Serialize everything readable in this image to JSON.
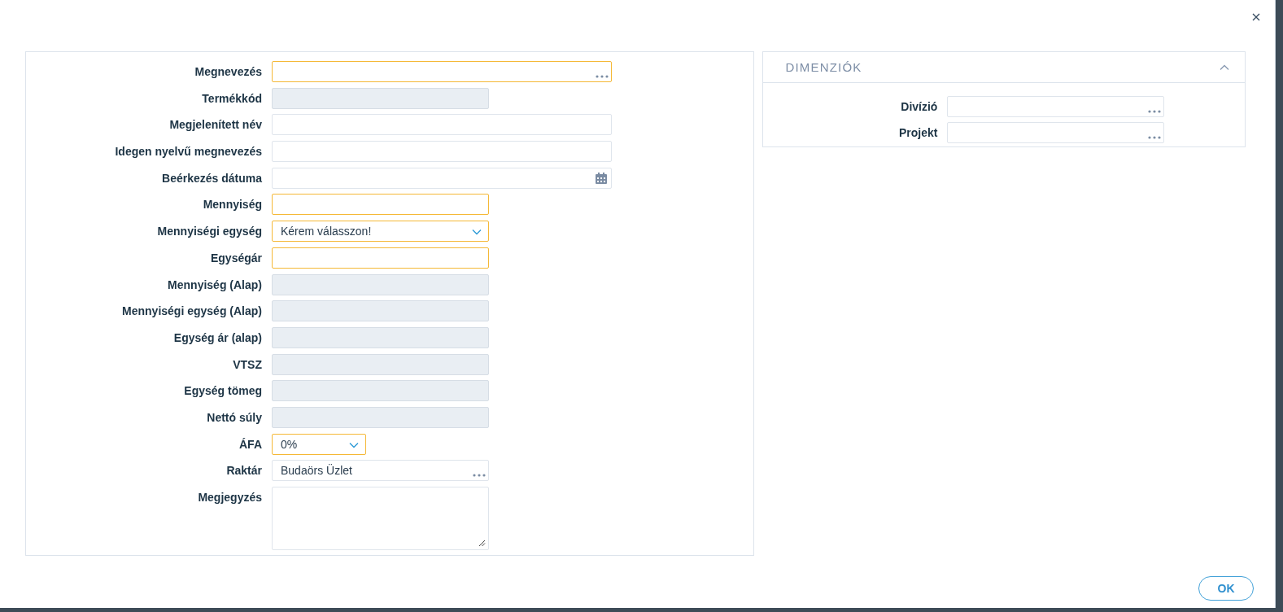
{
  "form": {
    "fields": [
      {
        "label": "Megnevezés",
        "kind": "lookup",
        "required": true
      },
      {
        "label": "Termékkód",
        "kind": "readonly"
      },
      {
        "label": "Megjelenített név",
        "kind": "text",
        "required": false
      },
      {
        "label": "Idegen nyelvű megnevezés",
        "kind": "text",
        "required": false
      },
      {
        "label": "Beérkezés dátuma",
        "kind": "date",
        "required": false
      },
      {
        "label": "Mennyiség",
        "kind": "text",
        "required": true
      },
      {
        "label": "Mennyiségi egység",
        "kind": "select",
        "required": true,
        "value": "Kérem válasszon!"
      },
      {
        "label": "Egységár",
        "kind": "text",
        "required": true
      },
      {
        "label": "Mennyiség (Alap)",
        "kind": "readonly"
      },
      {
        "label": "Mennyiségi egység (Alap)",
        "kind": "readonly"
      },
      {
        "label": "Egység ár (alap)",
        "kind": "readonly"
      },
      {
        "label": "VTSZ",
        "kind": "readonly"
      },
      {
        "label": "Egység tömeg",
        "kind": "readonly"
      },
      {
        "label": "Nettó súly",
        "kind": "readonly"
      },
      {
        "label": "ÁFA",
        "kind": "select",
        "required": true,
        "value": "0%"
      },
      {
        "label": "Raktár",
        "kind": "lookup",
        "required": false,
        "value": "Budaörs Üzlet"
      },
      {
        "label": "Megjegyzés",
        "kind": "textarea",
        "required": false
      }
    ]
  },
  "dimensions": {
    "title": "DIMENZIÓK",
    "expanded": true,
    "fields": [
      {
        "label": "Divízió",
        "required": false
      },
      {
        "label": "Projekt",
        "required": false
      }
    ]
  },
  "buttons": [
    {
      "label": "OK"
    }
  ]
}
